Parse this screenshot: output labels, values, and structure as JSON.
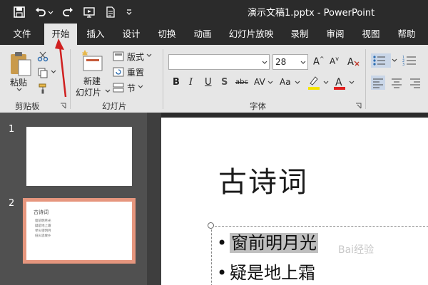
{
  "window": {
    "title": "演示文稿1.pptx  -  PowerPoint"
  },
  "quick_access": {
    "save_icon": "save-icon",
    "undo_icon": "undo-icon",
    "redo_icon": "redo-icon",
    "present_icon": "present-icon",
    "doc_icon": "doc-icon",
    "customize_icon": "chevron-down-icon"
  },
  "tabs": [
    {
      "label": "文件"
    },
    {
      "label": "开始"
    },
    {
      "label": "插入"
    },
    {
      "label": "设计"
    },
    {
      "label": "切换"
    },
    {
      "label": "动画"
    },
    {
      "label": "幻灯片放映"
    },
    {
      "label": "录制"
    },
    {
      "label": "审阅"
    },
    {
      "label": "视图"
    },
    {
      "label": "帮助"
    }
  ],
  "active_tab": "开始",
  "ribbon": {
    "clipboard": {
      "paste": "粘贴",
      "label": "剪贴板"
    },
    "slides": {
      "new_slide_1": "新建",
      "new_slide_2": "幻灯片",
      "layout": "版式",
      "reset": "重置",
      "section": "节",
      "label": "幻灯片"
    },
    "font": {
      "font_name": "",
      "font_size": "28",
      "label": "字体"
    }
  },
  "thumbnails": [
    {
      "number": "1"
    },
    {
      "number": "2",
      "title": "古诗词",
      "lines": [
        "窗前明月光",
        "疑是地上霜",
        "举头望明月",
        "低头思故乡"
      ]
    }
  ],
  "slide": {
    "title": "古诗词",
    "bullets": [
      "窗前明月光",
      "疑是地上霜"
    ]
  },
  "watermark": "Bai经验",
  "colors": {
    "accent": "#d04a2a",
    "thumb_selected_border": "#e6967e"
  }
}
